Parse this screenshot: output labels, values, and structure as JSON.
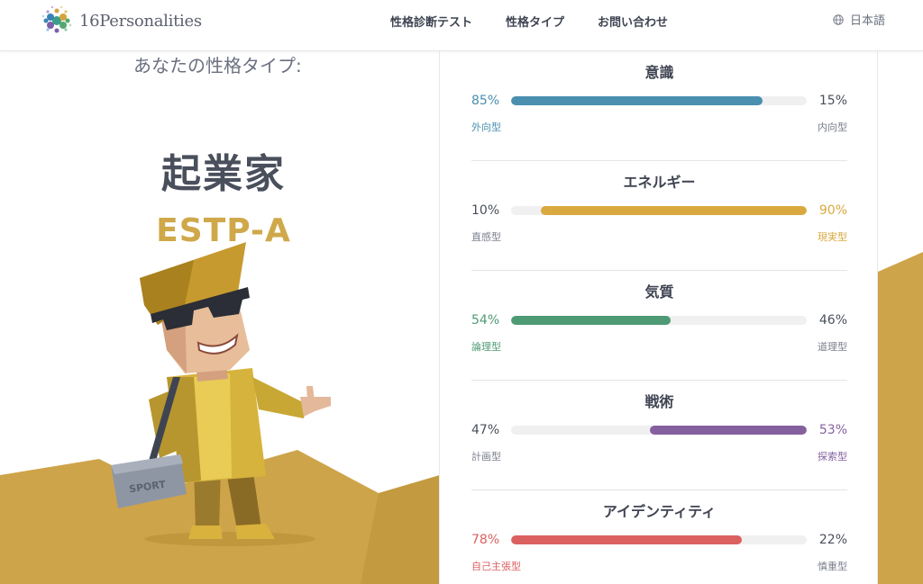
{
  "header": {
    "logo_text": "16Personalities",
    "nav": [
      "性格診断テスト",
      "性格タイプ",
      "お問い合わせ"
    ],
    "language": "日本語"
  },
  "result": {
    "subtitle": "あなたの性格タイプ:",
    "type_name": "起業家",
    "type_code": "ESTP-A",
    "character_bag_text": "SPORT"
  },
  "traits": [
    {
      "title": "意識",
      "left_pct": "85%",
      "right_pct": "15%",
      "left_label": "外向型",
      "right_label": "内向型",
      "fill_side": "left",
      "fill_fraction": 0.85,
      "color": "#4a8fb0"
    },
    {
      "title": "エネルギー",
      "left_pct": "10%",
      "right_pct": "90%",
      "left_label": "直感型",
      "right_label": "現実型",
      "fill_side": "right",
      "fill_fraction": 0.9,
      "color": "#d9a940"
    },
    {
      "title": "気質",
      "left_pct": "54%",
      "right_pct": "46%",
      "left_label": "論理型",
      "right_label": "道理型",
      "fill_side": "left",
      "fill_fraction": 0.54,
      "color": "#4e9a74"
    },
    {
      "title": "戦術",
      "left_pct": "47%",
      "right_pct": "53%",
      "left_label": "計画型",
      "right_label": "探索型",
      "fill_side": "right",
      "fill_fraction": 0.53,
      "color": "#85609e"
    },
    {
      "title": "アイデンティティ",
      "left_pct": "78%",
      "right_pct": "22%",
      "left_label": "自己主張型",
      "right_label": "慎重型",
      "fill_side": "left",
      "fill_fraction": 0.78,
      "color": "#db6060"
    }
  ]
}
